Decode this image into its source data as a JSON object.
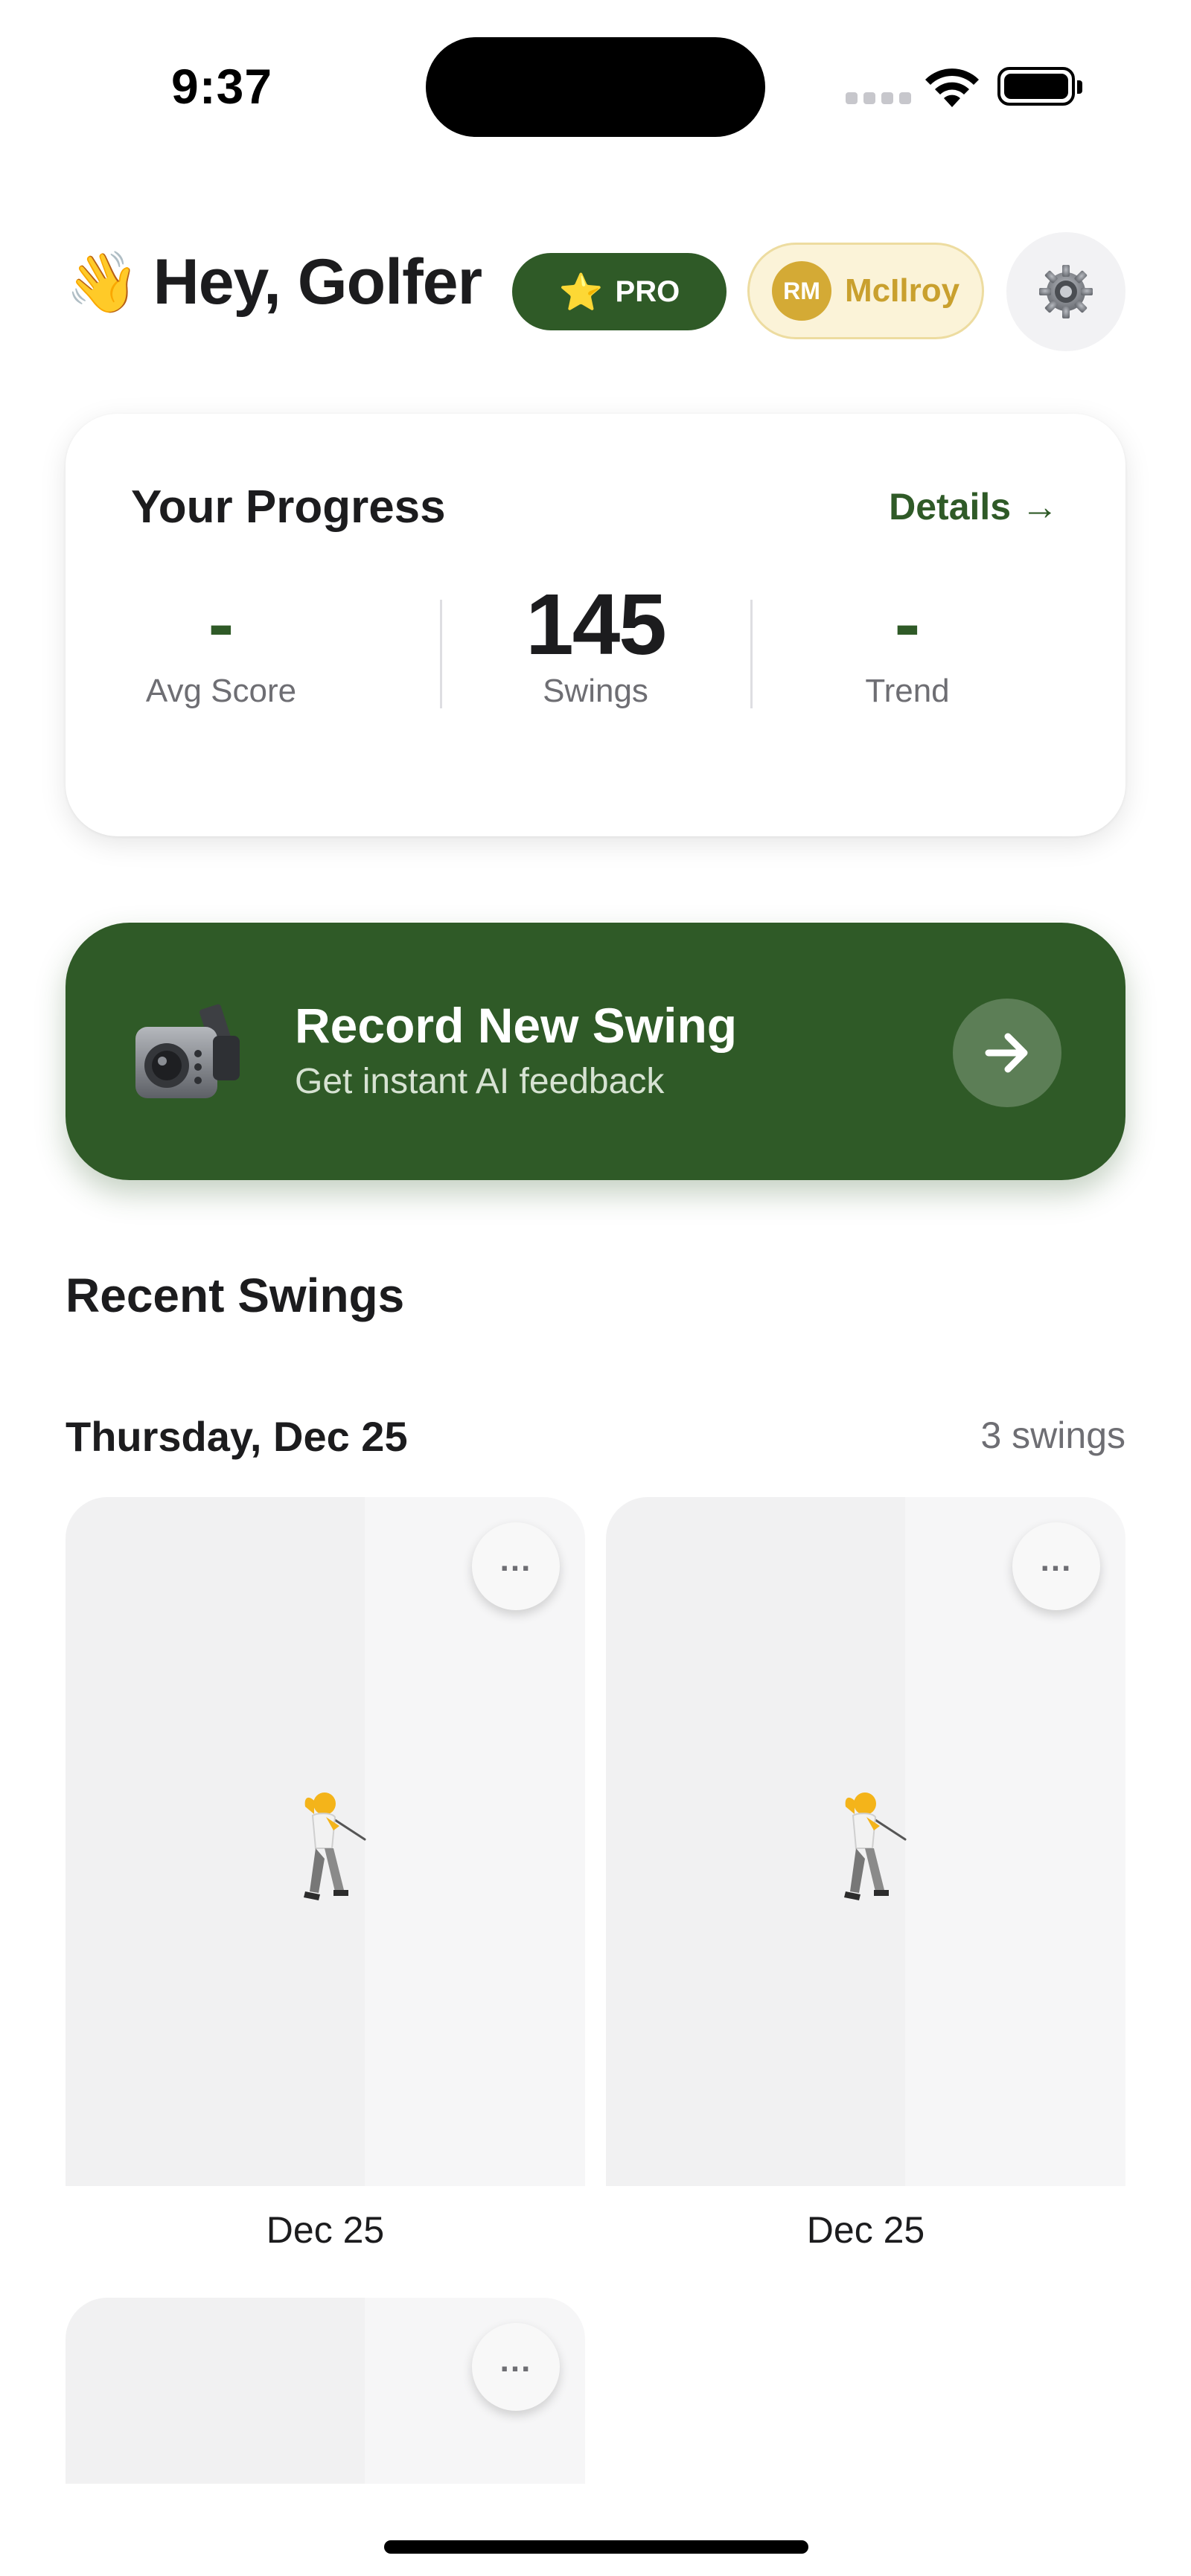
{
  "status_bar": {
    "time": "9:37"
  },
  "header": {
    "wave_icon": "👋",
    "greeting": "Hey, Golfer",
    "pro_badge": {
      "icon": "⭐",
      "label": "PRO"
    },
    "user": {
      "initials": "RM",
      "name": "McIlroy"
    },
    "settings_icon": "gear-icon"
  },
  "progress": {
    "title": "Your Progress",
    "details_link": "Details →",
    "stats": [
      {
        "value": "-",
        "label": "Avg Score"
      },
      {
        "value": "145",
        "label": "Swings"
      },
      {
        "value": "-",
        "label": "Trend"
      }
    ]
  },
  "record": {
    "icon": "video-camera-icon",
    "title": "Record New Swing",
    "subtitle": "Get instant AI feedback",
    "arrow_icon": "arrow-right-icon"
  },
  "recent": {
    "title": "Recent Swings",
    "groups": [
      {
        "date": "Thursday, Dec 25",
        "count": "3 swings",
        "swings": [
          {
            "label": "Dec 25",
            "more": "..."
          },
          {
            "label": "Dec 25",
            "more": "..."
          },
          {
            "label": "",
            "more": "..."
          }
        ]
      }
    ]
  },
  "colors": {
    "brand_green": "#2f5a27",
    "gold": "#d4aa35",
    "pill_bg": "#fbf3d8"
  }
}
